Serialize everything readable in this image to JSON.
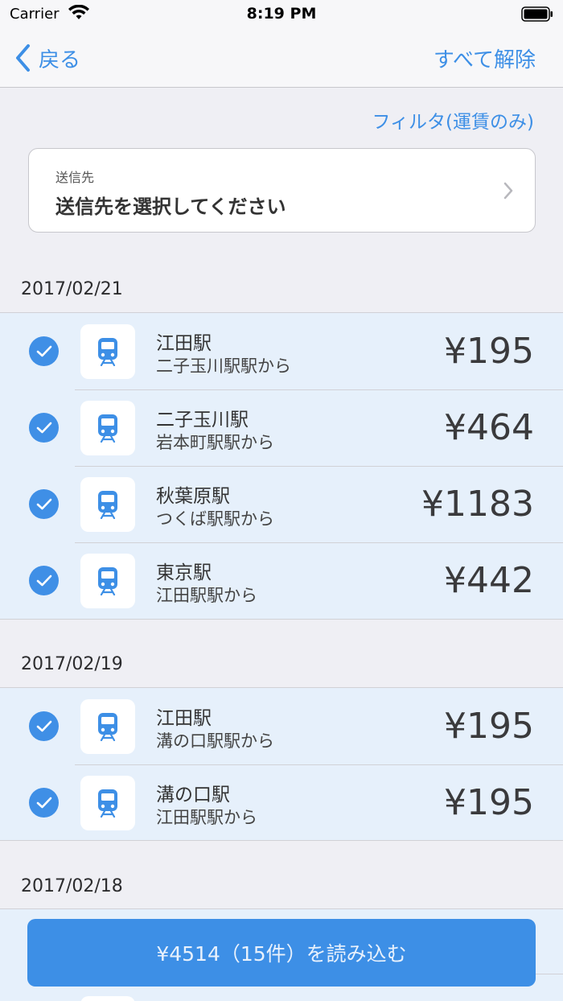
{
  "status_bar": {
    "carrier": "Carrier",
    "time": "8:19 PM"
  },
  "nav": {
    "back_label": "戻る",
    "clear_all_label": "すべて解除"
  },
  "filter_label": "フィルタ(運賃のみ)",
  "destination": {
    "caption": "送信先",
    "placeholder": "送信先を選択してください"
  },
  "sections": [
    {
      "date": "2017/02/21",
      "rows": [
        {
          "station": "江田駅",
          "origin": "二子玉川駅駅から",
          "price": "¥195",
          "checked": true
        },
        {
          "station": "二子玉川駅",
          "origin": "岩本町駅駅から",
          "price": "¥464",
          "checked": true
        },
        {
          "station": "秋葉原駅",
          "origin": "つくば駅駅から",
          "price": "¥1183",
          "checked": true
        },
        {
          "station": "東京駅",
          "origin": "江田駅駅から",
          "price": "¥442",
          "checked": true
        }
      ]
    },
    {
      "date": "2017/02/19",
      "rows": [
        {
          "station": "江田駅",
          "origin": "溝の口駅駅から",
          "price": "¥195",
          "checked": true
        },
        {
          "station": "溝の口駅",
          "origin": "江田駅駅から",
          "price": "¥195",
          "checked": true
        }
      ]
    },
    {
      "date": "2017/02/18",
      "rows": []
    }
  ],
  "load_button_label": "¥4514（15件）を読み込む",
  "colors": {
    "accent": "#3d8fe6",
    "row_bg": "#e6f0fb",
    "page_bg": "#efeff4"
  },
  "icons": {
    "row_icon": "train-icon",
    "check_icon": "checkmark-icon",
    "back_icon": "chevron-left-icon"
  }
}
